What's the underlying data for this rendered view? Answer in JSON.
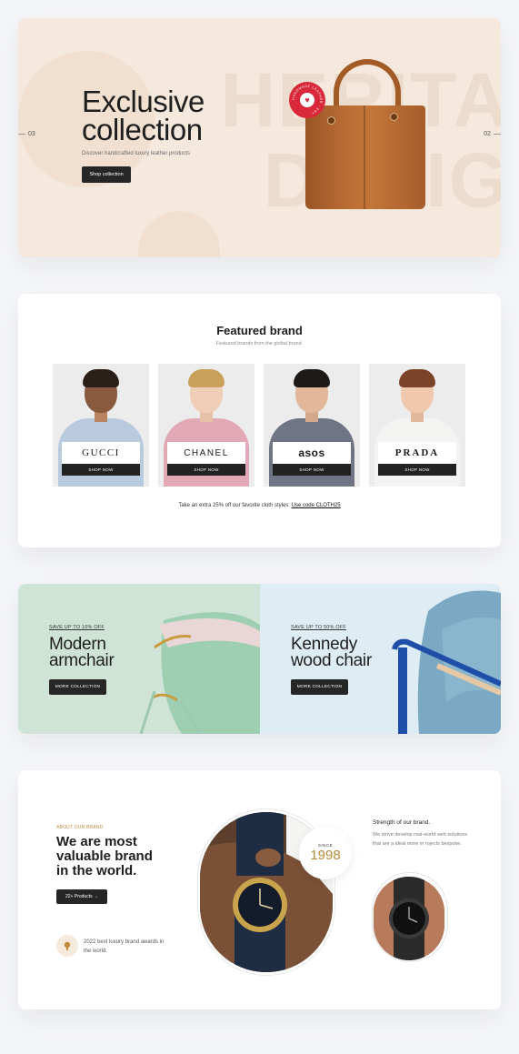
{
  "hero": {
    "title_line1": "Exclusive",
    "title_line2": "collection",
    "subtitle": "Discover handcrafted luxury leather products",
    "button_label": "Shop collection",
    "bg_word_line1": "HERITA",
    "bg_word_line2": "DESIG",
    "slide_prev_number": "03",
    "slide_next_number": "02",
    "seal_text": "HANDMADE LEATHER · EST · "
  },
  "brands": {
    "title": "Featured brand",
    "subtitle": "Featured brands from the global brand.",
    "items": [
      {
        "logo": "GUCCI",
        "button": "SHOP NOW"
      },
      {
        "logo": "CHANEL",
        "button": "SHOP NOW"
      },
      {
        "logo": "asos",
        "button": "SHOP NOW"
      },
      {
        "logo": "PRADA",
        "button": "SHOP NOW"
      }
    ],
    "promo_text": "Take an extra 25% off our favorite cloth styles: ",
    "promo_link": "Use code CLOTH25"
  },
  "chairs": [
    {
      "tag": "SAVE UP TO 10% OFF",
      "title_line1": "Modern",
      "title_line2": "armchair",
      "button": "MORE COLLECTION",
      "bg": "#cfe3d6"
    },
    {
      "tag": "SAVE UP TO 50% OFF",
      "title_line1": "Kennedy",
      "title_line2": "wood chair",
      "button": "MORE COLLECTION",
      "bg": "#deedf3"
    }
  ],
  "about": {
    "tag": "ABOUT OUR BRAND",
    "title_line1": "We are most",
    "title_line2": "valuable brand",
    "title_line3": "in the world.",
    "button": "22+ Products",
    "award_text": "2022 best luxury brand awards in the world.",
    "since_label": "SINCE",
    "since_year": "1998",
    "strength_title": "Strength of our brand.",
    "strength_text": "We strive develop real-world web solutions that are a ideal more in rojects bespoke."
  },
  "colors": {
    "accent_gold": "#b58a3a",
    "dark": "#262626",
    "seal_red": "#d9283a"
  }
}
